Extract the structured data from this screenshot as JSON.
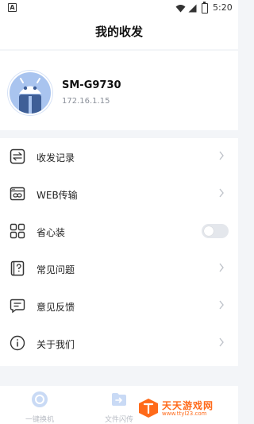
{
  "status_bar": {
    "notification_icon": "a-notification-icon",
    "time": "5:20"
  },
  "header": {
    "title": "我的收发"
  },
  "device": {
    "avatar_icon": "android-robot-icon",
    "name": "SM-G9730",
    "ip": "172.16.1.15"
  },
  "menu": {
    "items": [
      {
        "label": "收发记录",
        "icon": "swap-arrows-icon"
      },
      {
        "label": "WEB传输",
        "icon": "web-link-icon"
      },
      {
        "label": "省心装",
        "icon": "grid-apps-icon",
        "toggle": "off"
      },
      {
        "label": "常见问题",
        "icon": "question-book-icon"
      },
      {
        "label": "意见反馈",
        "icon": "feedback-message-icon"
      },
      {
        "label": "关于我们",
        "icon": "info-icon"
      }
    ]
  },
  "tabs": [
    {
      "label": "一键换机",
      "icon": "switch-phone-icon"
    },
    {
      "label": "文件闪传",
      "icon": "file-transfer-icon"
    }
  ],
  "watermark": {
    "title": "天天游戏网",
    "url": "www.ttyl23.com"
  },
  "colors": {
    "accent": "#a9c4ef",
    "background": "#f3f5f8",
    "watermark": "#ff6a1a"
  }
}
